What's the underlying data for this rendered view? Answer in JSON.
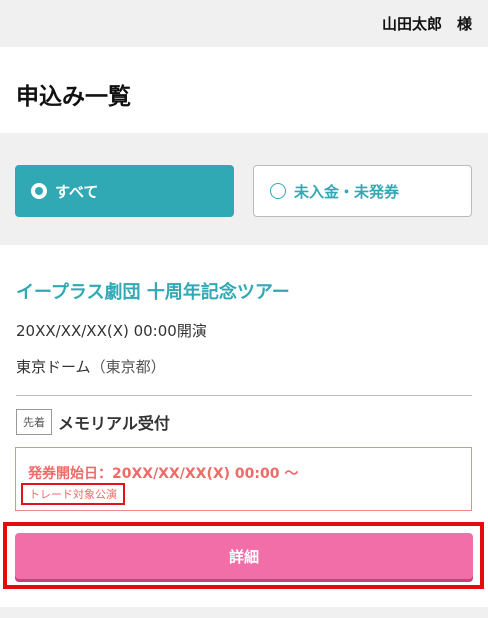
{
  "header": {
    "user_name": "山田太郎　様"
  },
  "page": {
    "title": "申込み一覧"
  },
  "filters": {
    "all_label": "すべて",
    "unpaid_label": "未入金・未発券",
    "selected": "all"
  },
  "application": {
    "event_title": "イープラス劇団 十周年記念ツアー",
    "performance_date": "20XX/XX/XX(X) 00:00開演",
    "venue": "東京ドーム",
    "venue_prefecture": "（東京都）",
    "reception_type_tag": "先着",
    "reception_name": "メモリアル受付",
    "ticket_issue_start": "発券開始日：20XX/XX/XX(X) 00:00 〜",
    "trade_badge": "トレード対象公演",
    "detail_button_label": "詳細"
  },
  "colors": {
    "accent": "#30a9b5",
    "detail_button": "#f26ea9",
    "notice_text": "#ee6b68",
    "highlight_outline": "#e30b0b"
  }
}
